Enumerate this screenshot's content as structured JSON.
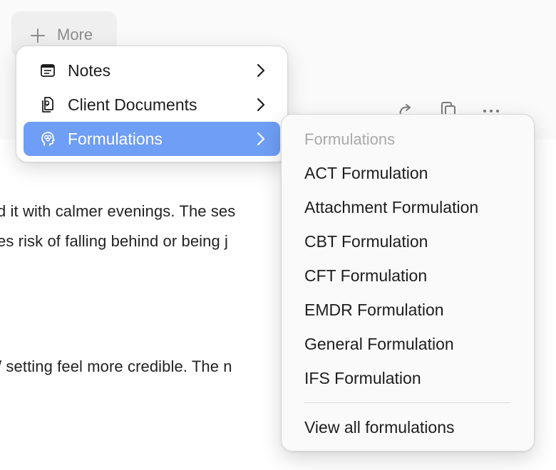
{
  "more_button": {
    "label": "More",
    "icon": "plus-icon"
  },
  "toolbar": {
    "icons": [
      "redo-icon",
      "copy-document-icon",
      "more-options-icon"
    ]
  },
  "content": {
    "lines": [
      "d it with calmer evenings. The ses",
      "es risk of falling behind or being j",
      "/ setting feel more credible. The n"
    ]
  },
  "menu": {
    "items": [
      {
        "label": "Notes",
        "icon": "notes-icon"
      },
      {
        "label": "Client Documents",
        "icon": "client-documents-icon"
      },
      {
        "label": "Formulations",
        "icon": "brain-head-icon",
        "selected": true
      }
    ]
  },
  "submenu": {
    "header": "Formulations",
    "items": [
      "ACT Formulation",
      "Attachment Formulation",
      "CBT Formulation",
      "CFT Formulation",
      "EMDR Formulation",
      "General Formulation",
      "IFS Formulation"
    ],
    "view_all": "View all formulations"
  },
  "colors": {
    "accent": "#6e9ef5",
    "menu_text": "#1d1d1f",
    "muted": "#a9a9a9"
  }
}
